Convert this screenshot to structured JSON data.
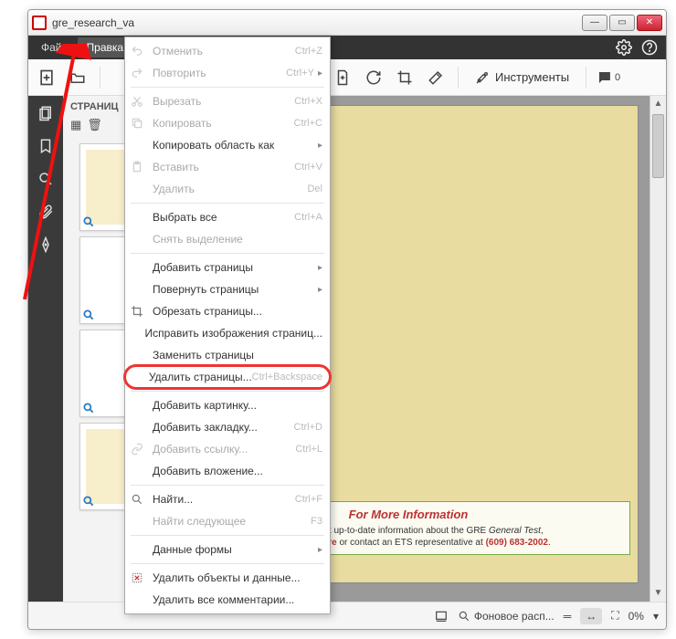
{
  "window": {
    "title": "gre_research_va"
  },
  "menubar": {
    "file": "Файл",
    "edit": "Правка"
  },
  "toolbar": {
    "instruments": "Инструменты"
  },
  "panel": {
    "title": "СТРАНИЦ"
  },
  "status": {
    "scaling": "Фоновое расп...",
    "zoom": "0%"
  },
  "doc": {
    "info_title": "For More Information",
    "info_line1_a": "o get the most up-to-date information about the GRE ",
    "info_line1_b": "General Test",
    "info_line1_c": ",",
    "info_line2_a": "www.ets.org/gre",
    "info_line2_b": " or contact an ETS representative at ",
    "info_line2_c": "(609) 683-2002",
    "info_line2_d": "."
  },
  "menu": {
    "items": [
      {
        "label": "Отменить",
        "shortcut": "Ctrl+Z",
        "disabled": true,
        "icon": "undo"
      },
      {
        "label": "Повторить",
        "shortcut": "Ctrl+Y",
        "disabled": true,
        "icon": "redo",
        "submenu": true
      },
      {
        "sep": true
      },
      {
        "label": "Вырезать",
        "shortcut": "Ctrl+X",
        "disabled": true,
        "icon": "cut"
      },
      {
        "label": "Копировать",
        "shortcut": "Ctrl+C",
        "disabled": true,
        "icon": "copy"
      },
      {
        "label": "Копировать область как",
        "submenu": true
      },
      {
        "label": "Вставить",
        "shortcut": "Ctrl+V",
        "disabled": true,
        "icon": "paste"
      },
      {
        "label": "Удалить",
        "shortcut": "Del",
        "disabled": true
      },
      {
        "sep": true
      },
      {
        "label": "Выбрать все",
        "shortcut": "Ctrl+A"
      },
      {
        "label": "Снять выделение",
        "disabled": true
      },
      {
        "sep": true
      },
      {
        "label": "Добавить страницы",
        "submenu": true
      },
      {
        "label": "Повернуть страницы",
        "submenu": true
      },
      {
        "label": "Обрезать страницы...",
        "icon": "crop"
      },
      {
        "label": "Исправить изображения страниц...",
        "trunc": true
      },
      {
        "label": "Заменить страницы",
        "trunc": true
      },
      {
        "label": "Удалить страницы...",
        "shortcut": "Ctrl+Backspace",
        "highlight": true
      },
      {
        "sep": true
      },
      {
        "label": "Добавить картинку..."
      },
      {
        "label": "Добавить закладку...",
        "shortcut": "Ctrl+D"
      },
      {
        "label": "Добавить ссылку...",
        "shortcut": "Ctrl+L",
        "disabled": true,
        "icon": "link"
      },
      {
        "label": "Добавить вложение..."
      },
      {
        "sep": true
      },
      {
        "label": "Найти...",
        "shortcut": "Ctrl+F",
        "icon": "find"
      },
      {
        "label": "Найти следующее",
        "shortcut": "F3",
        "disabled": true
      },
      {
        "sep": true
      },
      {
        "label": "Данные формы",
        "submenu": true
      },
      {
        "sep": true
      },
      {
        "label": "Удалить объекты и данные...",
        "icon": "delobj"
      },
      {
        "label": "Удалить все комментарии..."
      }
    ]
  }
}
